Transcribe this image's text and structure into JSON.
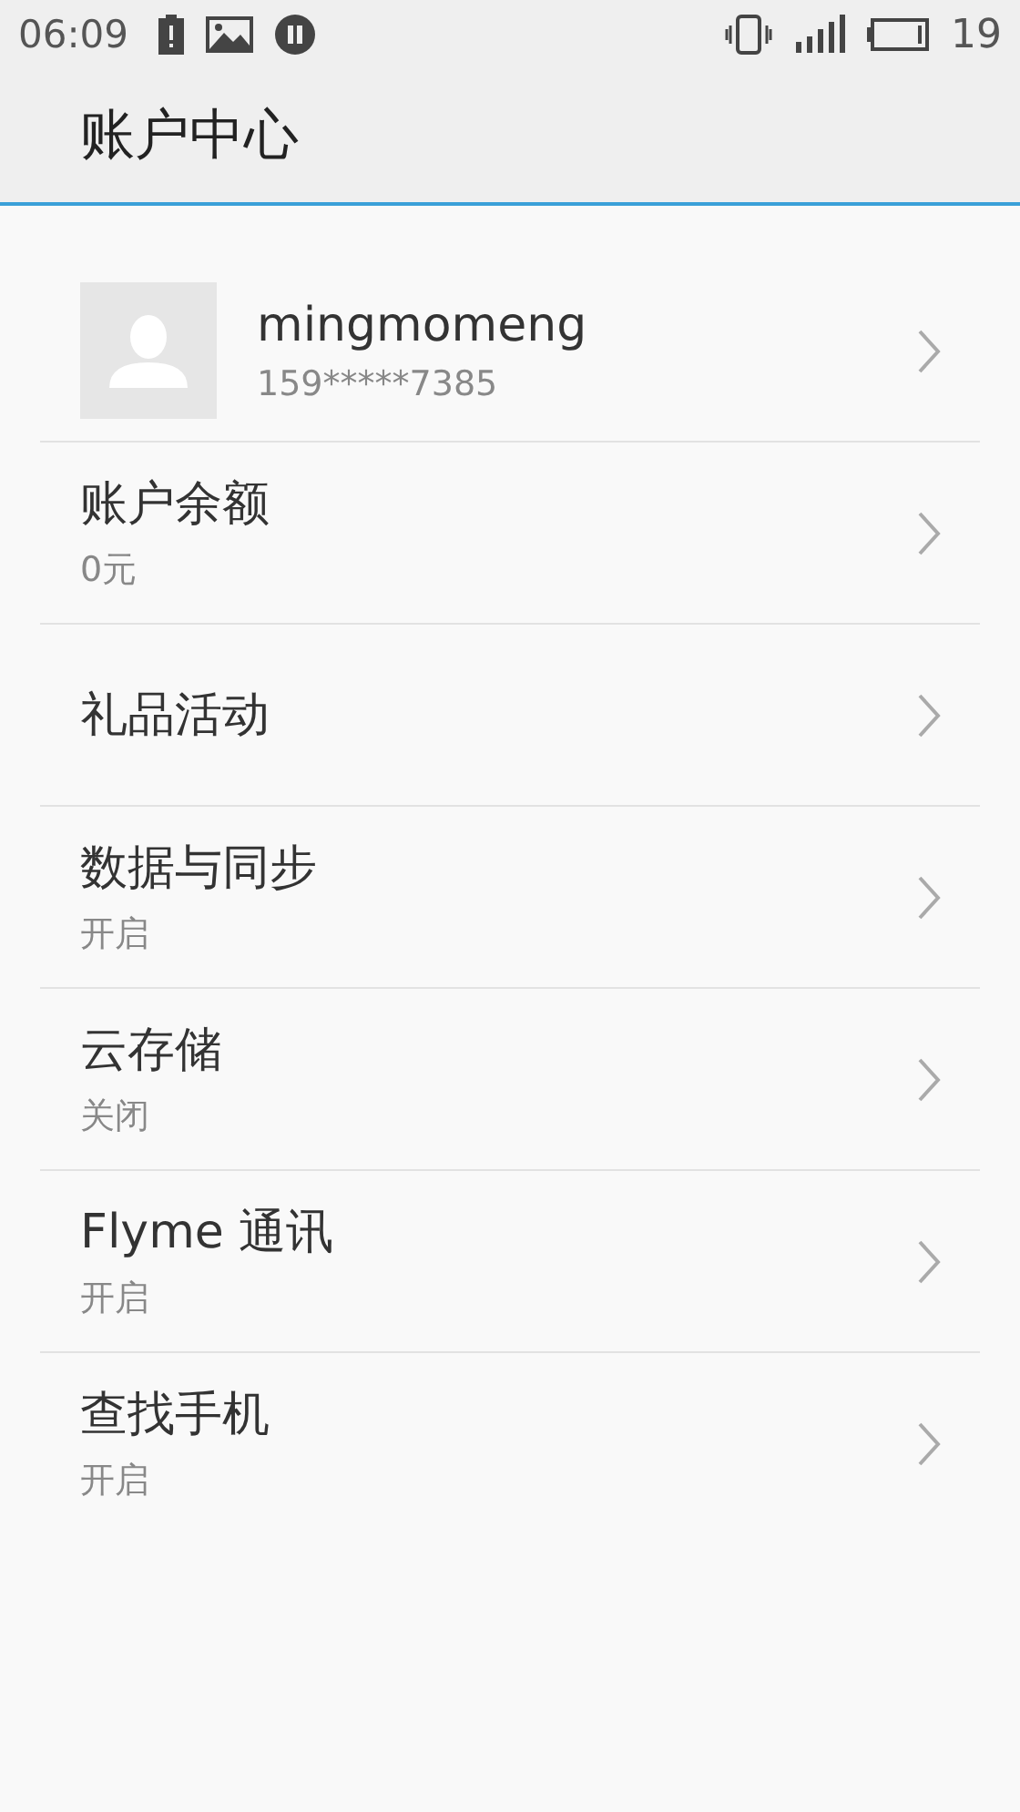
{
  "status_bar": {
    "time": "06:09",
    "battery": "19"
  },
  "header": {
    "title": "账户中心"
  },
  "profile": {
    "name": "mingmomeng",
    "phone": "159*****7385"
  },
  "items": [
    {
      "label": "账户余额",
      "value": "0元"
    },
    {
      "label": "礼品活动"
    },
    {
      "label": "数据与同步",
      "value": "开启"
    },
    {
      "label": "云存储",
      "value": "关闭"
    },
    {
      "label": "Flyme 通讯",
      "value": "开启"
    },
    {
      "label": "查找手机",
      "value": "开启"
    }
  ]
}
